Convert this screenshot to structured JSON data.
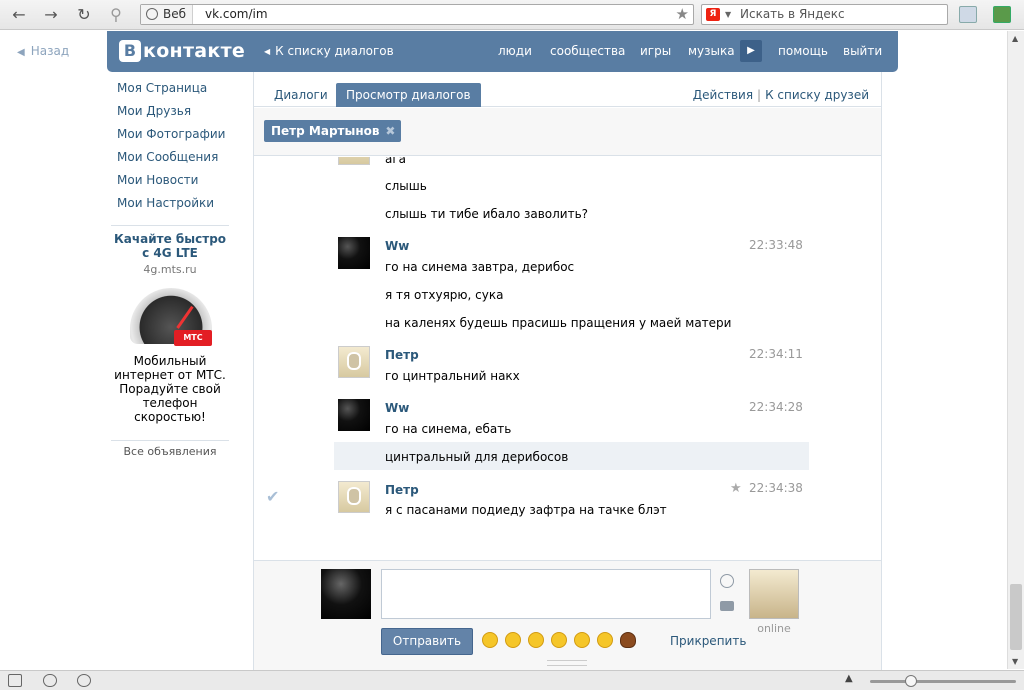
{
  "browser": {
    "web_label": "Веб",
    "url": "vk.com/im",
    "search_placeholder": "Искать в Яндекс",
    "yandex_logo": "Я"
  },
  "header": {
    "logo_box": "В",
    "logo_text": "контакте",
    "back_to_list": "К списку диалогов",
    "nav": [
      "люди",
      "сообщества",
      "игры",
      "музыка",
      "помощь",
      "выйти"
    ]
  },
  "back_link": "Назад",
  "left_menu": {
    "items": [
      "Моя Страница",
      "Мои Друзья",
      "Мои Фотографии",
      "Мои Сообщения",
      "Мои Новости",
      "Мои Настройки"
    ]
  },
  "ad": {
    "title": "Качайте быстро с 4G LTE",
    "domain": "4g.mts.ru",
    "badge": "МТС",
    "text": "Мобильный интернет от МТС. Порадуйте свой телефон скоростью!",
    "all_ads": "Все объявления"
  },
  "tabs": {
    "dialogs": "Диалоги",
    "view_dialogs": "Просмотр диалогов",
    "actions": "Действия",
    "friends_list": "К списку друзей"
  },
  "peer_chip": "Петр Мартынов",
  "messages": [
    {
      "sender": "",
      "time": "",
      "lines": [
        "ага",
        "слышь",
        "слышь ти тибе ибало заволить?"
      ]
    },
    {
      "sender": "Ww",
      "time": "22:33:48",
      "lines": [
        "го на синема завтра, дерибос",
        "я тя отхуярю, сука",
        "на каленях будешь прасишь пращения у маей матери"
      ]
    },
    {
      "sender": "Петр",
      "time": "22:34:11",
      "lines": [
        "го цинтральний накх"
      ]
    },
    {
      "sender": "Ww",
      "time": "22:34:28",
      "lines": [
        "го на синема, ебать",
        "цинтральный для дерибосов"
      ]
    },
    {
      "sender": "Петр",
      "time": "22:34:38",
      "lines": [
        "я с пасанами подиеду зафтра на тачке блэт"
      ]
    }
  ],
  "composer": {
    "send": "Отправить",
    "attach": "Прикрепить",
    "status": "online"
  },
  "colors": {
    "vk_blue": "#597da3",
    "link": "#2b587a",
    "highlight": "#edf1f5"
  }
}
